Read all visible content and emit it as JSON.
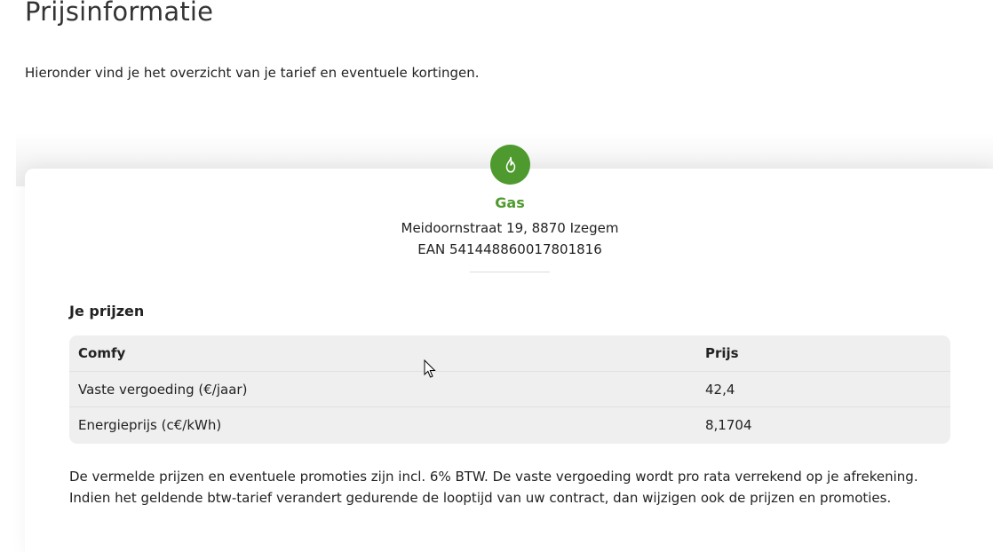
{
  "page": {
    "title": "Prijsinformatie",
    "intro": "Hieronder vind je het overzicht van je tarief en eventuele kortingen."
  },
  "product": {
    "icon": "flame-icon",
    "type": "Gas",
    "address": "Meidoornstraat 19, 8870 Izegem",
    "ean": "EAN 541448860017801816",
    "accent_color": "#4e9a2e"
  },
  "prices": {
    "section_title": "Je prijzen",
    "columns": [
      "Comfy",
      "Prijs"
    ],
    "rows": [
      {
        "label": "Vaste vergoeding (€/jaar)",
        "value": "42,4"
      },
      {
        "label": "Energieprijs (c€/kWh)",
        "value": "8,1704"
      }
    ]
  },
  "footnote": "De vermelde prijzen en eventuele promoties zijn incl. 6% BTW. De vaste vergoeding wordt pro rata verrekend op je afrekening. Indien het geldende btw-tarief verandert gedurende de looptijd van uw contract, dan wijzigen ook de prijzen en promoties."
}
